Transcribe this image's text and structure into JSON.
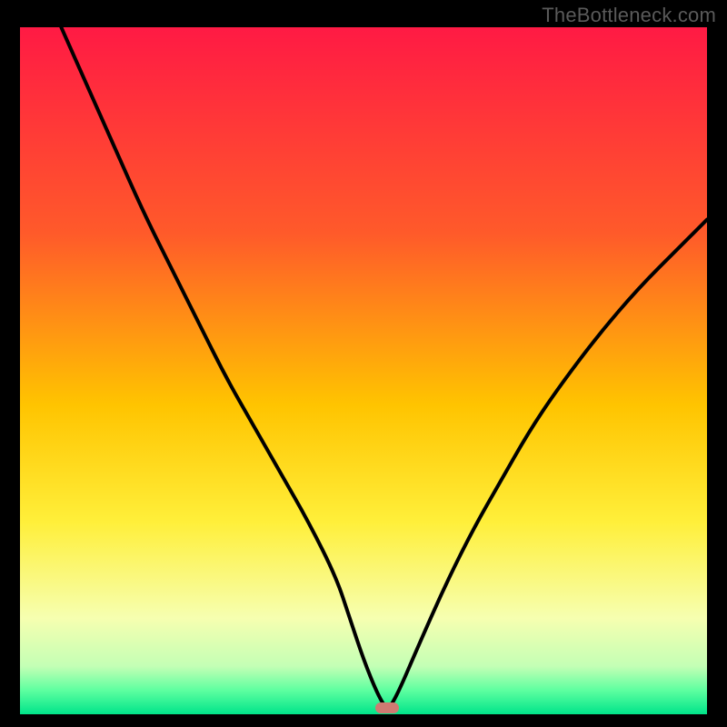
{
  "watermark": "TheBottleneck.com",
  "chart_data": {
    "type": "line",
    "title": "",
    "xlabel": "",
    "ylabel": "",
    "xlim": [
      0,
      100
    ],
    "ylim": [
      0,
      100
    ],
    "gradient_stops": [
      {
        "offset": 0,
        "color": "#ff1a44"
      },
      {
        "offset": 0.3,
        "color": "#ff5a2a"
      },
      {
        "offset": 0.55,
        "color": "#ffc400"
      },
      {
        "offset": 0.72,
        "color": "#ffef3a"
      },
      {
        "offset": 0.86,
        "color": "#f6ffb0"
      },
      {
        "offset": 0.93,
        "color": "#c4ffb5"
      },
      {
        "offset": 0.965,
        "color": "#5effa0"
      },
      {
        "offset": 1.0,
        "color": "#00e48a"
      }
    ],
    "series": [
      {
        "name": "bottleneck-curve",
        "x": [
          6,
          10,
          14,
          18,
          22,
          26,
          30,
          34,
          38,
          42,
          46,
          48,
          50,
          52,
          53.5,
          55,
          58,
          62,
          66,
          70,
          74,
          78,
          84,
          90,
          96,
          100
        ],
        "y": [
          100,
          91,
          82,
          73,
          65,
          57,
          49,
          42,
          35,
          28,
          20,
          14,
          8,
          3,
          0.5,
          3,
          10,
          19,
          27,
          34,
          41,
          47,
          55,
          62,
          68,
          72
        ]
      }
    ],
    "marker": {
      "x": 53.5,
      "y": 0.9,
      "color": "#cf7a72"
    },
    "annotations": []
  }
}
